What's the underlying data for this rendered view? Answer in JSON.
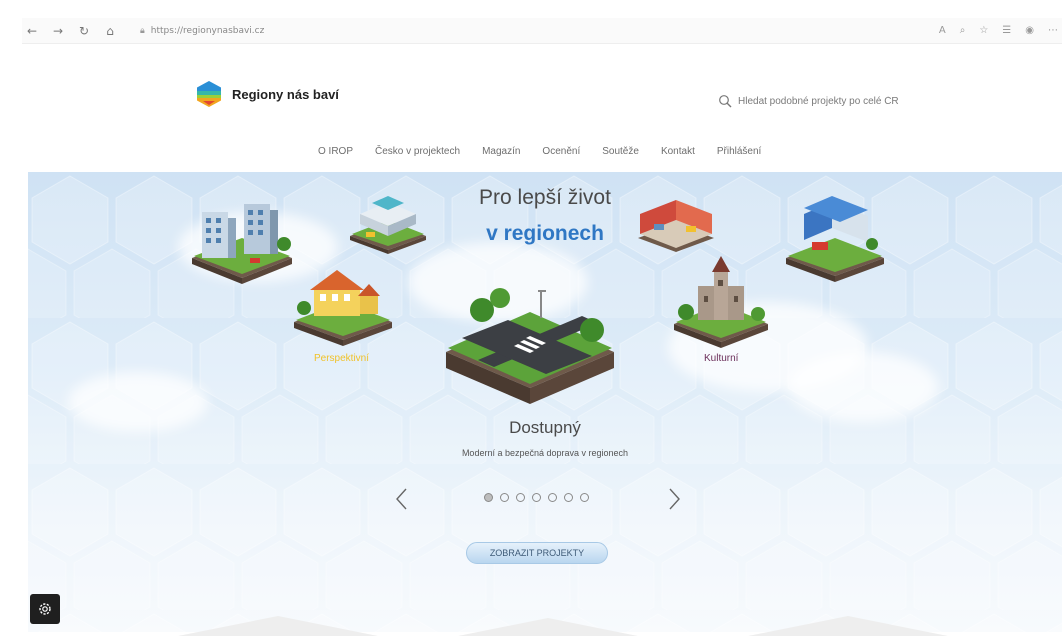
{
  "browser": {
    "url": "https://regionynasbavi.cz"
  },
  "header": {
    "logo_text": "Regiony nás baví",
    "search_placeholder": "Hledat podobné projekty po celé ČR"
  },
  "nav": {
    "items": [
      "O IROP",
      "Česko v projektech",
      "Magazín",
      "Ocenění",
      "Soutěže",
      "Kontakt",
      "Přihlášení"
    ]
  },
  "hero": {
    "title_line1": "Pro lepší život",
    "title_line2": "v regionech",
    "label_left": "Perspektivní",
    "label_right": "Kulturní",
    "slide_title": "Dostupný",
    "slide_description": "Moderní a bezpečná doprava v regionech",
    "slide_count": 7,
    "active_slide": 0,
    "cta_label": "ZOBRAZIT PROJEKTY"
  },
  "colors": {
    "accent_blue": "#2f77c4",
    "label_yellow": "#f0c22a",
    "label_purple": "#6b2f5a"
  },
  "icons": {
    "toolbar": [
      "back-icon",
      "forward-icon",
      "reload-icon",
      "home-icon",
      "lock-icon"
    ],
    "toolbar_right": [
      "read-aloud-icon",
      "zoom-icon",
      "favorite-icon",
      "collections-icon",
      "profile-icon",
      "more-icon"
    ],
    "search": "search-icon",
    "settings": "gear-icon"
  }
}
